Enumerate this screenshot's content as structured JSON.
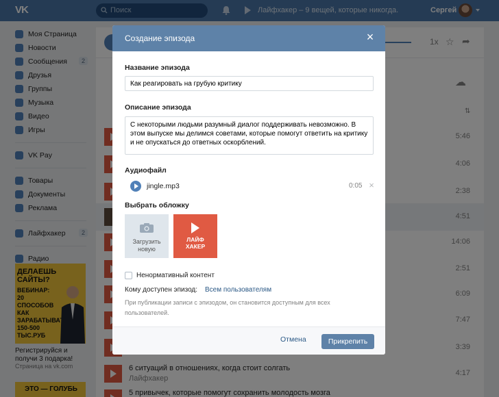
{
  "topbar": {
    "logo": "VK",
    "search_placeholder": "Поиск",
    "now_playing": "Лайфхакер – 9 вещей, которые никогда.",
    "user_name": "Сергей"
  },
  "sidebar": {
    "items": [
      {
        "label": "Моя Страница",
        "icon": "home-icon"
      },
      {
        "label": "Новости",
        "icon": "news-icon"
      },
      {
        "label": "Сообщения",
        "icon": "messages-icon",
        "count": "2"
      },
      {
        "label": "Друзья",
        "icon": "friends-icon"
      },
      {
        "label": "Группы",
        "icon": "groups-icon"
      },
      {
        "label": "Музыка",
        "icon": "music-icon"
      },
      {
        "label": "Видео",
        "icon": "video-icon"
      },
      {
        "label": "Игры",
        "icon": "games-icon"
      }
    ],
    "pay_item": {
      "label": "VK Pay",
      "icon": "vkpay-icon"
    },
    "items2": [
      {
        "label": "Товары",
        "icon": "goods-icon"
      },
      {
        "label": "Документы",
        "icon": "documents-icon"
      },
      {
        "label": "Реклама",
        "icon": "ads-icon"
      }
    ],
    "community": {
      "label": "Лайфхакер",
      "count": "2",
      "icon": "community-icon"
    },
    "radio": {
      "label": "Радио",
      "icon": "radio-icon"
    },
    "ad": {
      "headline": "ДЕЛАЕШЬ САЙТЫ?",
      "body": "ВЕБИНАР: 20 СПОСОБОВ КАК ЗАРАБАТЫВАТЬ 150-500 ТЫС.РУБ",
      "caption": "Регистрируйся и получи 3 подарка!",
      "source": "Страница на vk.com"
    },
    "ad2_text": "ЭТО — ГОЛУБЬ"
  },
  "main": {
    "speed": "1x",
    "tracks": [
      {
        "title": "",
        "artist": "",
        "duration": "5:46"
      },
      {
        "title": "",
        "artist": "",
        "duration": "4:06"
      },
      {
        "title": "",
        "artist": "",
        "duration": "2:38"
      },
      {
        "title": "",
        "artist": "",
        "duration": "4:51"
      },
      {
        "title": "",
        "artist": "",
        "duration": "14:06"
      },
      {
        "title": "",
        "artist": "",
        "duration": "2:51"
      },
      {
        "title": "",
        "artist": "",
        "duration": "6:09"
      },
      {
        "title": "",
        "artist": "",
        "duration": "7:47"
      },
      {
        "title": "",
        "artist": "",
        "duration": "3:39"
      },
      {
        "title": "6 ситуаций в отношениях, когда стоит солгать",
        "artist": "Лайфхакер",
        "duration": "4:17"
      },
      {
        "title": "5 привычек, которые помогут сохранить молодость мозга",
        "artist": "",
        "duration": ""
      }
    ]
  },
  "modal": {
    "title": "Создание эпизода",
    "name_label": "Название эпизода",
    "name_value": "Как реагировать на грубую критику",
    "desc_label": "Описание эпизода",
    "desc_value": "С некоторыми людьми разумный диалог поддерживать невозможно. В этом выпуске мы делимся советами, которые помогут ответить на критику и не опускаться до ответных оскорблений.",
    "audio_label": "Аудиофайл",
    "audio_file": "jingle.mp3",
    "audio_duration": "0:05",
    "cover_label": "Выбрать обложку",
    "upload_text": "Загрузить новую",
    "brand_text": "ЛАЙФ\nХАКЕР",
    "explicit_label": "Ненормативный контент",
    "who_label": "Кому доступен эпизод:",
    "who_value": "Всем пользователям",
    "hint": "При публикации записи с эпизодом, он становится доступным для всех пользователей.",
    "cancel_label": "Отмена",
    "attach_label": "Прикрепить"
  }
}
